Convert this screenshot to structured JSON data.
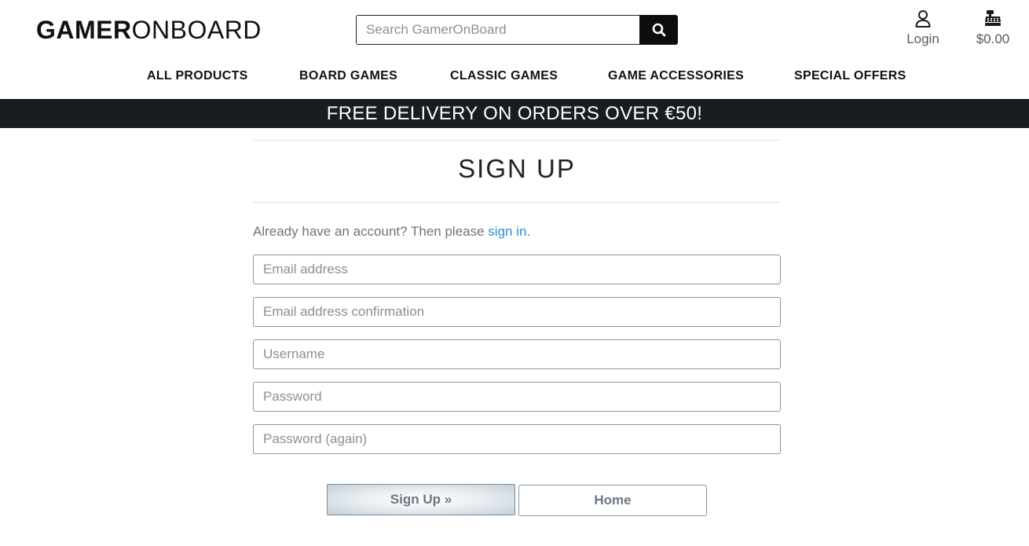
{
  "brand": {
    "logo_bold": "GAMER",
    "logo_light": "ONBOARD"
  },
  "search": {
    "placeholder": "Search GamerOnBoard",
    "icon": "search-icon"
  },
  "account": {
    "icon": "user-icon",
    "label": "Login"
  },
  "cart": {
    "icon": "cash-register-icon",
    "total": "$0.00"
  },
  "nav": {
    "items": [
      {
        "label": "ALL PRODUCTS"
      },
      {
        "label": "BOARD GAMES"
      },
      {
        "label": "CLASSIC GAMES"
      },
      {
        "label": "GAME ACCESSORIES"
      },
      {
        "label": "SPECIAL OFFERS"
      }
    ]
  },
  "banner": {
    "text": "FREE DELIVERY ON ORDERS OVER €50!"
  },
  "page": {
    "title": "SIGN UP",
    "intro_text": "Already have an account? Then please ",
    "intro_link": "sign in",
    "intro_end": "."
  },
  "form": {
    "fields": [
      {
        "placeholder": "Email address",
        "value": ""
      },
      {
        "placeholder": "Email address confirmation",
        "value": ""
      },
      {
        "placeholder": "Username",
        "value": ""
      },
      {
        "placeholder": "Password",
        "value": ""
      },
      {
        "placeholder": "Password (again)",
        "value": ""
      }
    ],
    "signup_label": "Sign Up »",
    "home_label": "Home"
  },
  "colors": {
    "banner_bg": "#1a1d20",
    "link": "#2f8fd4",
    "search_button_bg": "#0d0d0d"
  }
}
